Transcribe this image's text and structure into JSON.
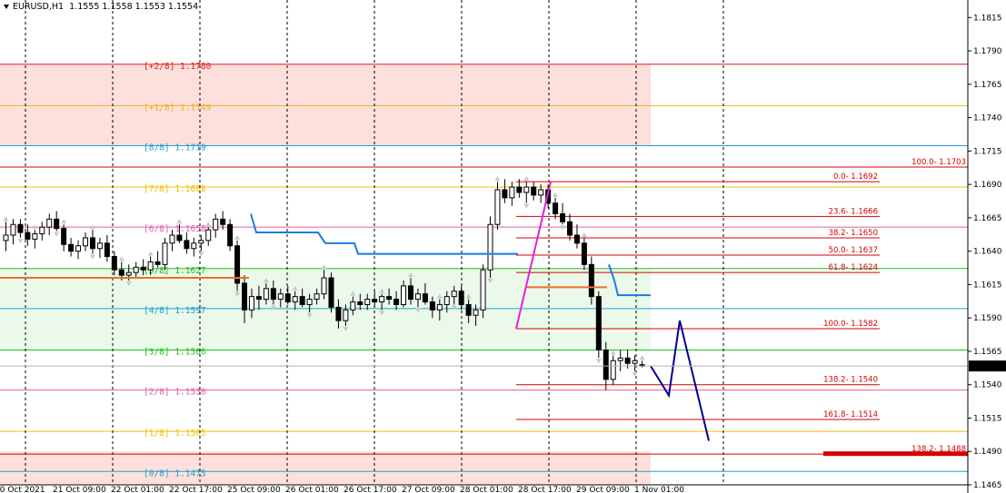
{
  "header": {
    "symbol": "EURUSD,H1",
    "ohlc": "1.1555 1.1558 1.1553 1.1554"
  },
  "colors": {
    "background": "#ffffff",
    "candle_up": "#ffffff",
    "candle_down": "#000000",
    "grid_vertical": "#000000",
    "murrey_zone_top": "#fde0dc",
    "murrey_zone_mid": "#eaf9ea",
    "fib_red": "#d40000",
    "trend_blue": "#1e7be0",
    "trend_orange": "#f07020",
    "zigzag_magenta": "#e020e0",
    "projection_navy": "#000090",
    "current_price_bg": "#000000"
  },
  "price_axis": {
    "ticks": [
      "1.1815",
      "1.1790",
      "1.1765",
      "1.1740",
      "1.1715",
      "1.1690",
      "1.1665",
      "1.1640",
      "1.1615",
      "1.1590",
      "1.1565",
      "1.1540",
      "1.1515",
      "1.1490",
      "1.1465"
    ],
    "current_price": "1.1554"
  },
  "time_axis": {
    "labels": [
      "20 Oct 2021",
      "21 Oct 09:00",
      "22 Oct 01:00",
      "22 Oct 17:00",
      "25 Oct 09:00",
      "26 Oct 01:00",
      "26 Oct 17:00",
      "27 Oct 09:00",
      "28 Oct 01:00",
      "28 Oct 17:00",
      "29 Oct 09:00",
      "1 Nov 01:00"
    ]
  },
  "murrey_levels": [
    {
      "label": "[+2/8]",
      "price": "1.1780",
      "color": "#e02020"
    },
    {
      "label": "[+1/8]",
      "price": "1.1749",
      "color": "#f0b020"
    },
    {
      "label": "[8/8]",
      "price": "1.1719",
      "color": "#20a0d0"
    },
    {
      "label": "[7/8]",
      "price": "1.1688",
      "color": "#f0c000"
    },
    {
      "label": "[6/8]",
      "price": "1.1658",
      "color": "#e060a0"
    },
    {
      "label": "[5/8]",
      "price": "1.1627",
      "color": "#20c020"
    },
    {
      "label": "[4/8]",
      "price": "1.1597",
      "color": "#20a0d0"
    },
    {
      "label": "[3/8]",
      "price": "1.1566",
      "color": "#20c020"
    },
    {
      "label": "[2/8]",
      "price": "1.1536",
      "color": "#e060a0"
    },
    {
      "label": "[1/8]",
      "price": "1.1505",
      "color": "#f0c000"
    },
    {
      "label": "[0/8]",
      "price": "1.1475",
      "color": "#20a0d0"
    }
  ],
  "fib_levels": [
    {
      "label": "100.0- 1.1703",
      "value": 1.1703
    },
    {
      "label": "0.0- 1.1692",
      "value": 1.1692
    },
    {
      "label": "23.6- 1.1666",
      "value": 1.1666
    },
    {
      "label": "38.2- 1.1650",
      "value": 1.165
    },
    {
      "label": "50.0- 1.1637",
      "value": 1.1637
    },
    {
      "label": "61.8- 1.1624",
      "value": 1.1624
    },
    {
      "label": "100.0- 1.1582",
      "value": 1.1582
    },
    {
      "label": "138.2- 1.1540",
      "value": 1.154
    },
    {
      "label": "161.8- 1.1514",
      "value": 1.1514
    },
    {
      "label": "138.2- 1.1488",
      "value": 1.1488
    }
  ],
  "chart_data": {
    "type": "candlestick",
    "title": "EURUSD,H1",
    "ylim": [
      1.1465,
      1.1822
    ],
    "grid": "vertical dotted",
    "candles": [
      [
        1.1648,
        1.1662,
        1.164,
        1.1652
      ],
      [
        1.1652,
        1.1664,
        1.1645,
        1.166
      ],
      [
        1.166,
        1.1664,
        1.165,
        1.1654
      ],
      [
        1.1654,
        1.166,
        1.1644,
        1.1649
      ],
      [
        1.1649,
        1.1656,
        1.1642,
        1.1653
      ],
      [
        1.1653,
        1.1662,
        1.1648,
        1.1658
      ],
      [
        1.1658,
        1.1668,
        1.1652,
        1.1664
      ],
      [
        1.1664,
        1.167,
        1.1655,
        1.1657
      ],
      [
        1.1657,
        1.166,
        1.164,
        1.1645
      ],
      [
        1.1645,
        1.165,
        1.1636,
        1.164
      ],
      [
        1.164,
        1.1648,
        1.1634,
        1.1644
      ],
      [
        1.1644,
        1.1654,
        1.164,
        1.165
      ],
      [
        1.165,
        1.1656,
        1.1638,
        1.1642
      ],
      [
        1.1642,
        1.165,
        1.1635,
        1.1646
      ],
      [
        1.1646,
        1.1652,
        1.1632,
        1.1636
      ],
      [
        1.1636,
        1.164,
        1.1622,
        1.1626
      ],
      [
        1.1626,
        1.1632,
        1.1618,
        1.1622
      ],
      [
        1.1622,
        1.163,
        1.1618,
        1.1624
      ],
      [
        1.1624,
        1.1632,
        1.162,
        1.1628
      ],
      [
        1.1628,
        1.1634,
        1.1622,
        1.1626
      ],
      [
        1.1626,
        1.1636,
        1.1622,
        1.1632
      ],
      [
        1.1632,
        1.164,
        1.1628,
        1.163
      ],
      [
        1.163,
        1.165,
        1.1626,
        1.1646
      ],
      [
        1.1646,
        1.1656,
        1.164,
        1.1652
      ],
      [
        1.1652,
        1.166,
        1.1646,
        1.1648
      ],
      [
        1.1648,
        1.1654,
        1.1638,
        1.1642
      ],
      [
        1.1642,
        1.165,
        1.1636,
        1.1646
      ],
      [
        1.1646,
        1.1652,
        1.164,
        1.1648
      ],
      [
        1.1648,
        1.1658,
        1.1644,
        1.1656
      ],
      [
        1.1656,
        1.1668,
        1.165,
        1.1664
      ],
      [
        1.1664,
        1.167,
        1.1656,
        1.166
      ],
      [
        1.166,
        1.1664,
        1.164,
        1.1644
      ],
      [
        1.1644,
        1.1648,
        1.161,
        1.1616
      ],
      [
        1.1616,
        1.1622,
        1.1586,
        1.1596
      ],
      [
        1.1596,
        1.1612,
        1.159,
        1.1606
      ],
      [
        1.1606,
        1.1614,
        1.1596,
        1.1604
      ],
      [
        1.1604,
        1.1616,
        1.16,
        1.1612
      ],
      [
        1.1612,
        1.1618,
        1.16,
        1.1604
      ],
      [
        1.1604,
        1.1612,
        1.1598,
        1.1608
      ],
      [
        1.1608,
        1.1614,
        1.16,
        1.1602
      ],
      [
        1.1602,
        1.161,
        1.1596,
        1.1606
      ],
      [
        1.1606,
        1.1612,
        1.1598,
        1.16
      ],
      [
        1.16,
        1.1608,
        1.1594,
        1.1604
      ],
      [
        1.1604,
        1.1612,
        1.16,
        1.1608
      ],
      [
        1.1608,
        1.1626,
        1.1604,
        1.162
      ],
      [
        1.162,
        1.1624,
        1.1594,
        1.1598
      ],
      [
        1.1598,
        1.1604,
        1.1582,
        1.1588
      ],
      [
        1.1588,
        1.16,
        1.1584,
        1.1596
      ],
      [
        1.1596,
        1.1606,
        1.1592,
        1.1602
      ],
      [
        1.1602,
        1.1608,
        1.1596,
        1.16
      ],
      [
        1.16,
        1.1608,
        1.1596,
        1.1604
      ],
      [
        1.1604,
        1.161,
        1.1598,
        1.1602
      ],
      [
        1.1602,
        1.1608,
        1.1596,
        1.1606
      ],
      [
        1.1606,
        1.1612,
        1.16,
        1.1604
      ],
      [
        1.1604,
        1.161,
        1.1596,
        1.16
      ],
      [
        1.16,
        1.1618,
        1.1598,
        1.1614
      ],
      [
        1.1614,
        1.162,
        1.16,
        1.1604
      ],
      [
        1.1604,
        1.1612,
        1.1598,
        1.1608
      ],
      [
        1.1608,
        1.1616,
        1.16,
        1.1602
      ],
      [
        1.1602,
        1.1606,
        1.159,
        1.1596
      ],
      [
        1.1596,
        1.1604,
        1.1588,
        1.16
      ],
      [
        1.16,
        1.161,
        1.1594,
        1.1606
      ],
      [
        1.1606,
        1.1614,
        1.16,
        1.161
      ],
      [
        1.161,
        1.1614,
        1.1596,
        1.16
      ],
      [
        1.16,
        1.1604,
        1.1586,
        1.1592
      ],
      [
        1.1592,
        1.16,
        1.1584,
        1.1596
      ],
      [
        1.1596,
        1.163,
        1.159,
        1.1626
      ],
      [
        1.1626,
        1.1666,
        1.162,
        1.166
      ],
      [
        1.166,
        1.1692,
        1.1656,
        1.1686
      ],
      [
        1.1686,
        1.1694,
        1.1676,
        1.168
      ],
      [
        1.168,
        1.1692,
        1.1674,
        1.1688
      ],
      [
        1.1688,
        1.1694,
        1.168,
        1.1684
      ],
      [
        1.1684,
        1.1692,
        1.1676,
        1.1688
      ],
      [
        1.1688,
        1.1692,
        1.1678,
        1.1682
      ],
      [
        1.1682,
        1.169,
        1.1676,
        1.1686
      ],
      [
        1.1686,
        1.169,
        1.1672,
        1.1676
      ],
      [
        1.1676,
        1.168,
        1.1664,
        1.1668
      ],
      [
        1.1668,
        1.1676,
        1.166,
        1.1662
      ],
      [
        1.1662,
        1.1668,
        1.1648,
        1.1652
      ],
      [
        1.1652,
        1.166,
        1.1642,
        1.1646
      ],
      [
        1.1646,
        1.165,
        1.1626,
        1.163
      ],
      [
        1.163,
        1.1636,
        1.16,
        1.1606
      ],
      [
        1.1606,
        1.161,
        1.156,
        1.1566
      ],
      [
        1.1566,
        1.1572,
        1.1536,
        1.1544
      ],
      [
        1.1544,
        1.1562,
        1.154,
        1.1558
      ],
      [
        1.1558,
        1.1566,
        1.155,
        1.156
      ],
      [
        1.156,
        1.1566,
        1.1552,
        1.1556
      ],
      [
        1.1556,
        1.1562,
        1.155,
        1.1558
      ],
      [
        1.1555,
        1.1558,
        1.1553,
        1.1554
      ]
    ]
  }
}
